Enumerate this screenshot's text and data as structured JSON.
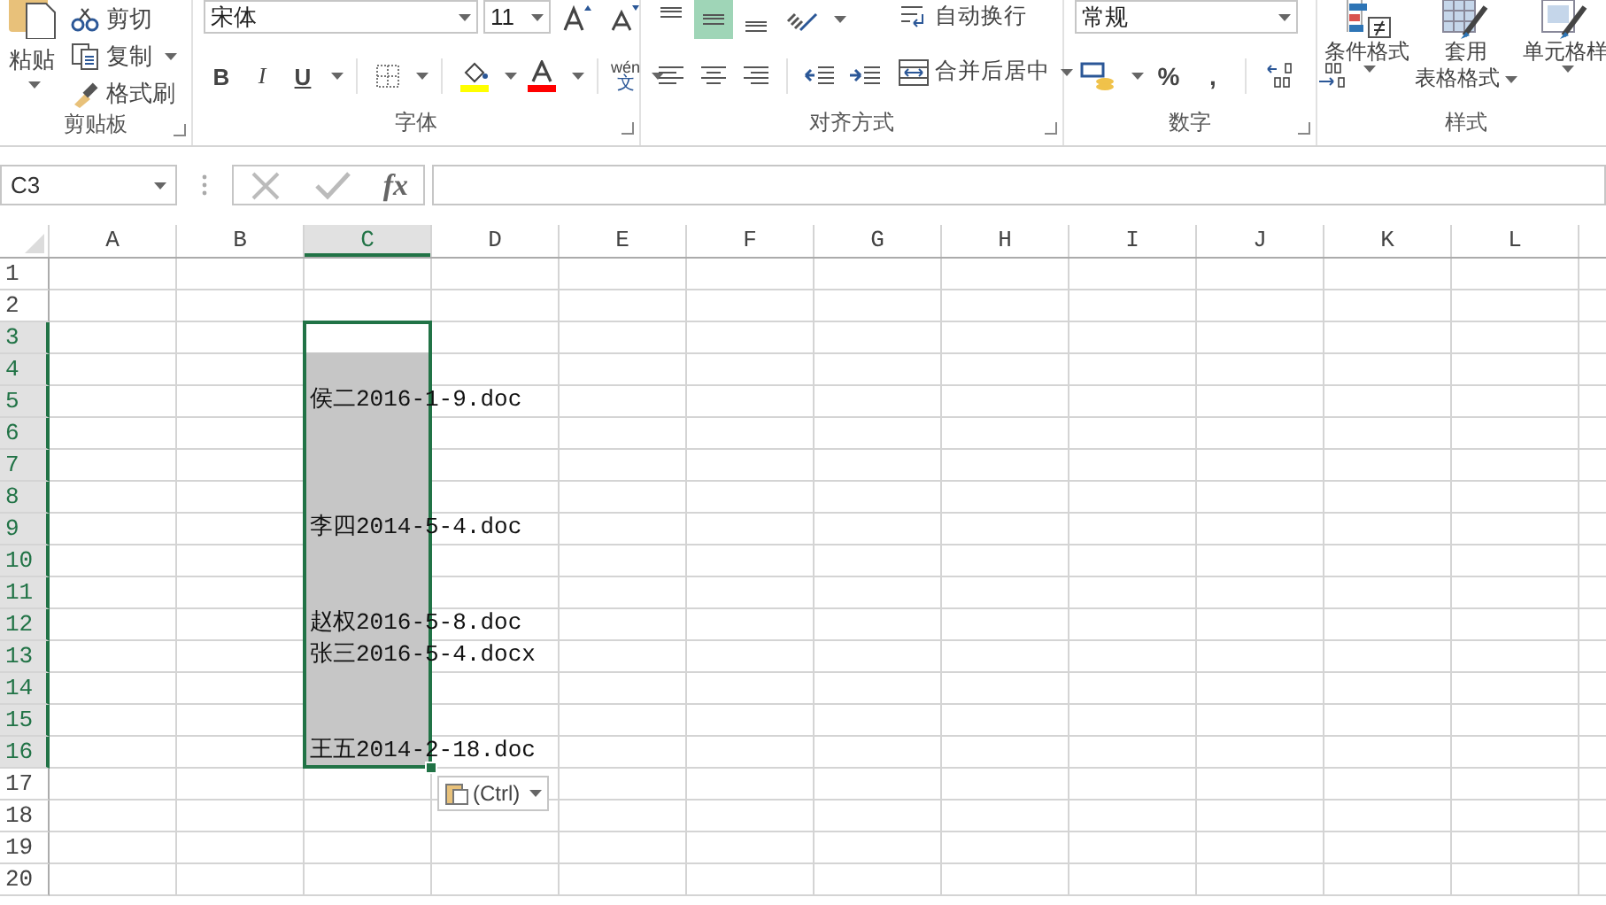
{
  "ribbon": {
    "clipboard": {
      "paste": "粘贴",
      "items": [
        {
          "kind": "cut",
          "label": "剪切"
        },
        {
          "kind": "copy",
          "label": "复制"
        },
        {
          "kind": "painter",
          "label": "格式刷"
        }
      ],
      "title": "剪贴板"
    },
    "font": {
      "font_name": "宋体",
      "font_size": "11",
      "styles": [
        {
          "kind": "bold",
          "label": "B"
        },
        {
          "kind": "italic",
          "label": "I"
        },
        {
          "kind": "underline",
          "label": "U"
        }
      ],
      "phonetic": {
        "top": "wén",
        "bottom": "文"
      },
      "title": "字体"
    },
    "alignment": {
      "vertical": [
        {
          "kind": "top",
          "selected": false
        },
        {
          "kind": "middle",
          "selected": true
        },
        {
          "kind": "bottom",
          "selected": false
        }
      ],
      "horizontal": [
        {
          "kind": "left",
          "selected": false
        },
        {
          "kind": "center",
          "selected": false
        },
        {
          "kind": "right",
          "selected": false
        }
      ],
      "wrap_text": "自动换行",
      "merge_center": "合并后居中",
      "title": "对齐方式"
    },
    "number": {
      "format": "常规",
      "percent": "%",
      "comma": ",",
      "title": "数字"
    },
    "styles": {
      "buttons": [
        {
          "kind": "conditional",
          "lines": [
            "条件格式"
          ]
        },
        {
          "kind": "table",
          "lines": [
            "套用",
            "表格格式"
          ]
        },
        {
          "kind": "cell",
          "lines": [
            "单元格样"
          ]
        }
      ],
      "title": "样式"
    }
  },
  "formula_bar": {
    "name_box": "C3",
    "fx": "fx"
  },
  "sheet": {
    "columns": [
      {
        "label": "A",
        "selected": false
      },
      {
        "label": "B",
        "selected": false
      },
      {
        "label": "C",
        "selected": true
      },
      {
        "label": "D",
        "selected": false
      },
      {
        "label": "E",
        "selected": false
      },
      {
        "label": "F",
        "selected": false
      },
      {
        "label": "G",
        "selected": false
      },
      {
        "label": "H",
        "selected": false
      },
      {
        "label": "I",
        "selected": false
      },
      {
        "label": "J",
        "selected": false
      },
      {
        "label": "K",
        "selected": false
      },
      {
        "label": "L",
        "selected": false
      }
    ],
    "rows": [
      {
        "label": "1",
        "selected": false,
        "active": false
      },
      {
        "label": "2",
        "selected": false,
        "active": false
      },
      {
        "label": "3",
        "selected": true,
        "active": true
      },
      {
        "label": "4",
        "selected": true,
        "active": false
      },
      {
        "label": "5",
        "selected": true,
        "active": false,
        "c": "侯二2016-1-9.doc"
      },
      {
        "label": "6",
        "selected": true,
        "active": false
      },
      {
        "label": "7",
        "selected": true,
        "active": false
      },
      {
        "label": "8",
        "selected": true,
        "active": false
      },
      {
        "label": "9",
        "selected": true,
        "active": false,
        "c": "李四2014-5-4.doc"
      },
      {
        "label": "10",
        "selected": true,
        "active": false
      },
      {
        "label": "11",
        "selected": true,
        "active": false
      },
      {
        "label": "12",
        "selected": true,
        "active": false,
        "c": "赵权2016-5-8.doc"
      },
      {
        "label": "13",
        "selected": true,
        "active": false,
        "c": "张三2016-5-4.docx"
      },
      {
        "label": "14",
        "selected": true,
        "active": false
      },
      {
        "label": "15",
        "selected": true,
        "active": false
      },
      {
        "label": "16",
        "selected": true,
        "active": false,
        "c": "王五2014-2-18.doc"
      },
      {
        "label": "17",
        "selected": false,
        "active": false
      },
      {
        "label": "18",
        "selected": false,
        "active": false
      },
      {
        "label": "19",
        "selected": false,
        "active": false
      },
      {
        "label": "20",
        "selected": false,
        "active": false
      }
    ],
    "paste_options": "(Ctrl)"
  }
}
